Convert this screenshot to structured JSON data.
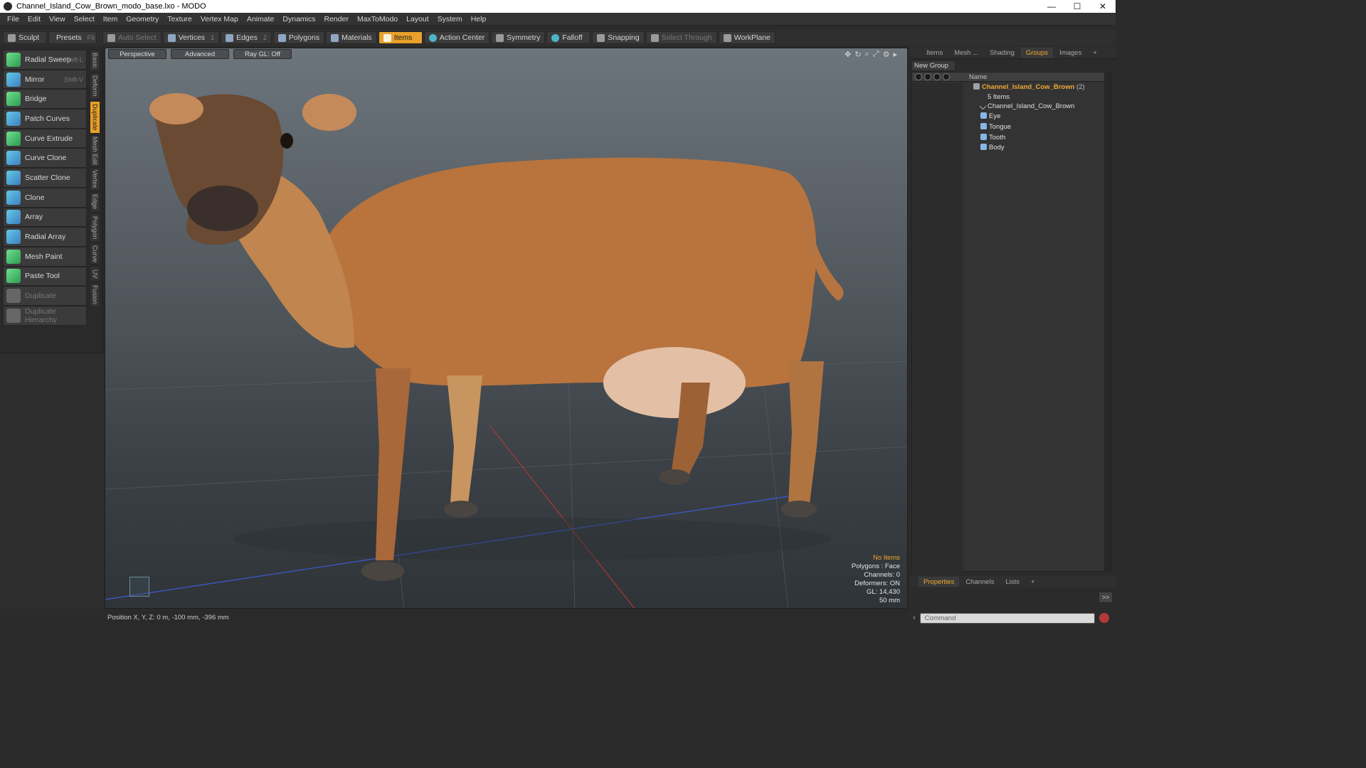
{
  "window": {
    "title": "Channel_Island_Cow_Brown_modo_base.lxo - MODO",
    "controls": [
      "—",
      "☐",
      "✕"
    ]
  },
  "menu": [
    "File",
    "Edit",
    "View",
    "Select",
    "Item",
    "Geometry",
    "Texture",
    "Vertex Map",
    "Animate",
    "Dynamics",
    "Render",
    "MaxToModo",
    "Layout",
    "System",
    "Help"
  ],
  "toolbar": {
    "sculpt": "Sculpt",
    "presets": "Presets",
    "presets_key": "F6",
    "auto_select": "Auto Select",
    "vertices": "Vertices",
    "vertices_key": "1",
    "edges": "Edges",
    "edges_key": "2",
    "polygons": "Polygons",
    "materials": "Materials",
    "items": "Items",
    "action_center": "Action Center",
    "symmetry": "Symmetry",
    "falloff": "Falloff",
    "snapping": "Snapping",
    "select_through": "Select Through",
    "workplane": "WorkPlane"
  },
  "tools": [
    {
      "label": "Radial Sweep",
      "shortcut": "Shift-L"
    },
    {
      "label": "Mirror",
      "shortcut": "Shift-V"
    },
    {
      "label": "Bridge",
      "shortcut": ""
    },
    {
      "label": "Patch Curves",
      "shortcut": ""
    },
    {
      "label": "Curve Extrude",
      "shortcut": ""
    },
    {
      "label": "Curve Clone",
      "shortcut": ""
    },
    {
      "label": "Scatter Clone",
      "shortcut": ""
    },
    {
      "label": "Clone",
      "shortcut": ""
    },
    {
      "label": "Array",
      "shortcut": ""
    },
    {
      "label": "Radial Array",
      "shortcut": ""
    },
    {
      "label": "Mesh Paint",
      "shortcut": ""
    },
    {
      "label": "Paste Tool",
      "shortcut": ""
    },
    {
      "label": "Duplicate",
      "shortcut": ""
    },
    {
      "label": "Duplicate Hierarchy",
      "shortcut": ""
    }
  ],
  "vtabs": [
    "Basic",
    "Deform",
    "Duplicate",
    "Mesh Edit",
    "Vertex",
    "Edge",
    "Polygon",
    "Curve",
    "UV",
    "Fusion"
  ],
  "viewport": {
    "view": "Perspective",
    "mode": "Advanced",
    "raygl": "Ray GL: Off",
    "info": {
      "line1": "No Items",
      "line2": "Polygons : Face",
      "line3": "Channels: 0",
      "line4": "Deformers: ON",
      "line5": "GL: 14,430",
      "line6": "50 mm"
    }
  },
  "status": {
    "position": "Position X, Y, Z:  0 m, -100 mm, -396 mm"
  },
  "right": {
    "tabs": [
      "Items",
      "Mesh ...",
      "Shading",
      "Groups",
      "Images",
      "+"
    ],
    "new_group": "New Group",
    "col_name": "Name",
    "root": "Channel_Island_Cow_Brown",
    "root_count": "(2)",
    "items_count": "5 Items",
    "children": [
      "Channel_Island_Cow_Brown",
      "Eye",
      "Tongue",
      "Tooth",
      "Body"
    ],
    "prop_tabs": [
      "Properties",
      "Channels",
      "Lists",
      "+"
    ],
    "expand": ">>",
    "command_placeholder": "Command"
  },
  "colors": {
    "accent": "#e8a12a",
    "cow_body": "#b9733d"
  }
}
